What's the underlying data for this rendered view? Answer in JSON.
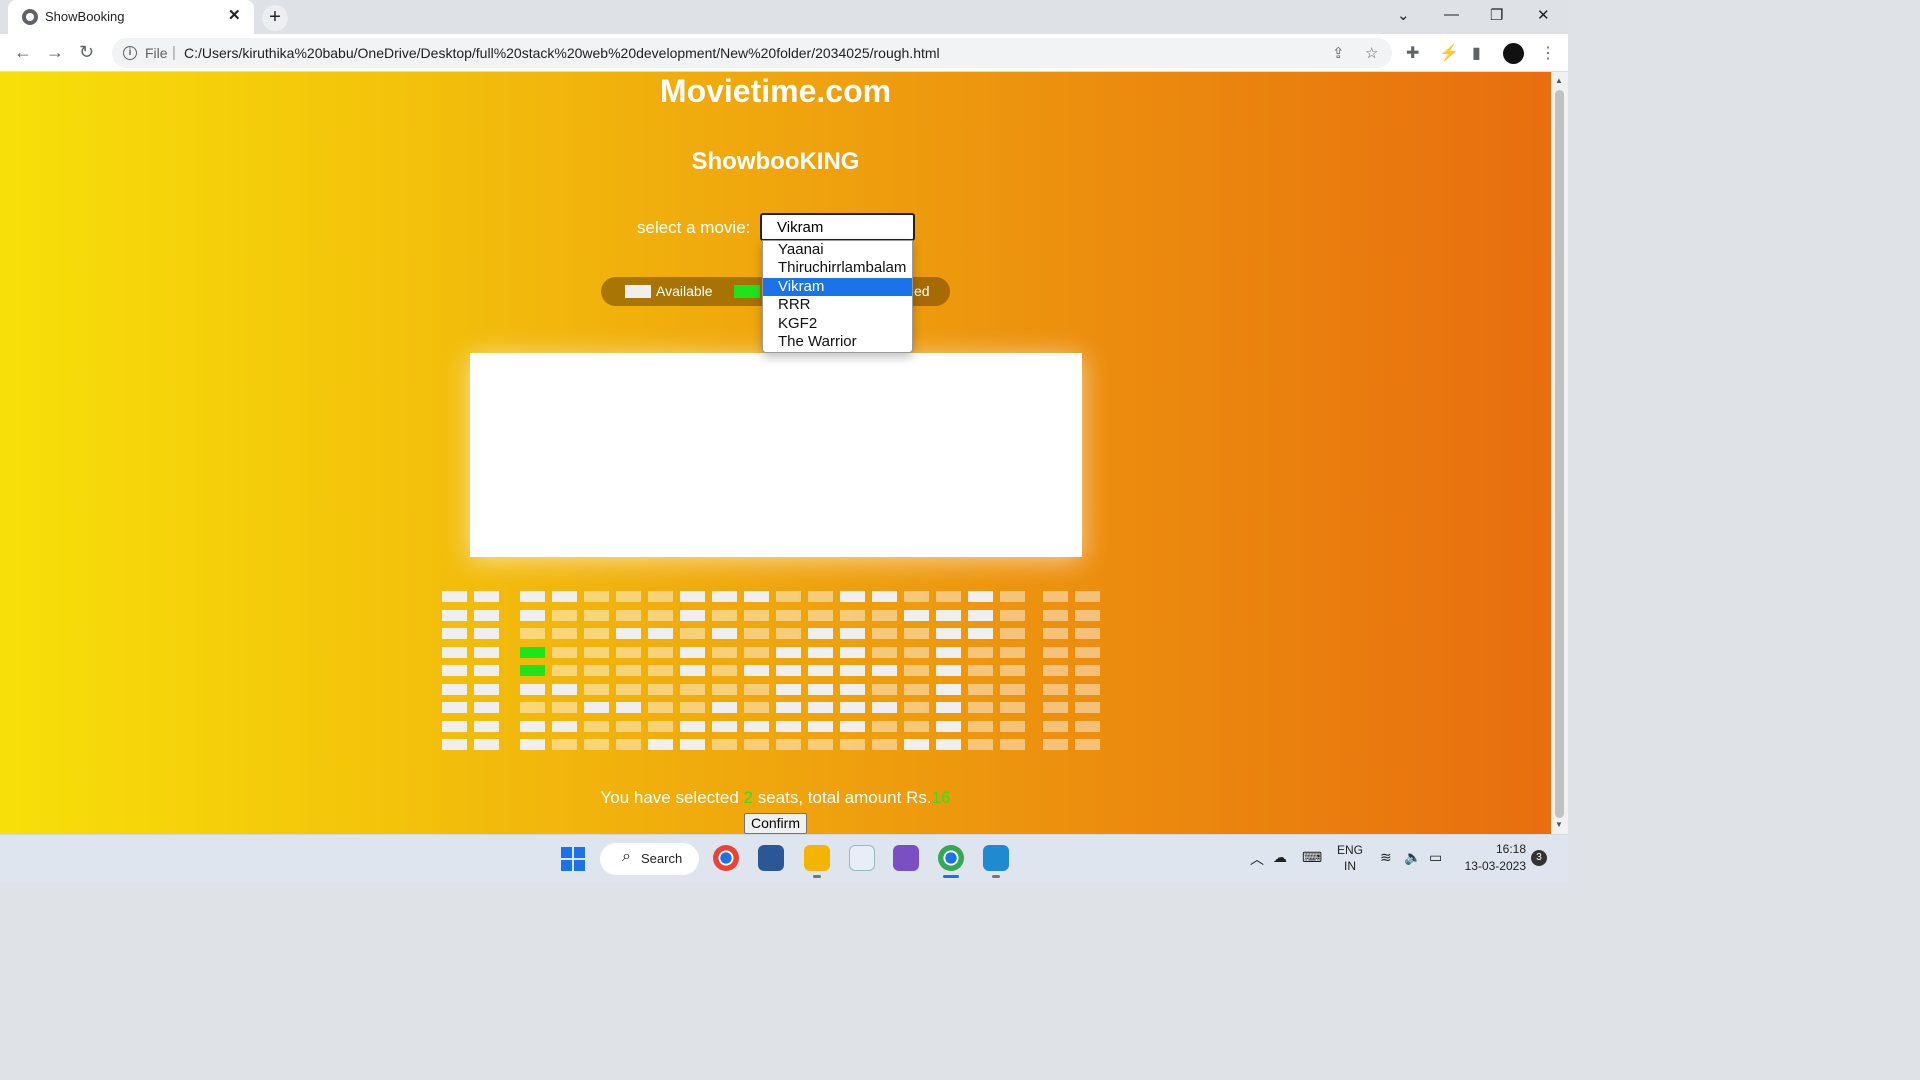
{
  "browser": {
    "tab_title": "ShowBooking",
    "tab_close": "✕",
    "new_tab": "+",
    "scheme_label": "File",
    "url_separator": "|",
    "url": "C:/Users/kiruthika%20babu/OneDrive/Desktop/full%20stack%20web%20development/New%20folder/2034025/rough.html",
    "icons": [
      "back-icon",
      "forward-icon",
      "reload-icon",
      "info-icon",
      "share-icon",
      "star-icon",
      "extensions-icon",
      "performance-icon",
      "side-panel-icon",
      "profile-avatar",
      "menu-icon",
      "minimize-icon",
      "restore-icon",
      "close-icon",
      "tab-search-icon"
    ]
  },
  "page": {
    "site_title": "Movietime.com",
    "sub_title": "ShowbooKING",
    "select_label": "select a movie:",
    "selected_movie": "Vikram",
    "movie_options": [
      "Yaanai",
      "Thiruchirrlambalam",
      "Vikram",
      "RRR",
      "KGF2",
      "The Warrior"
    ],
    "legend": {
      "available_label": "Available",
      "occupied_label_visible": "ed"
    },
    "summary": {
      "prefix": "You have selected ",
      "count": "2",
      "middle": " seats, total amount Rs.",
      "amount": "16"
    },
    "confirm_label": "Confirm",
    "colors": {
      "available": "#efefef",
      "selected": "#1ee51a",
      "occupied": "rgba(255,255,255,0.45)",
      "gradient_start": "#f7e009",
      "gradient_end": "#e86e0f"
    },
    "seating": {
      "rows": 9,
      "columns": 19,
      "legend_states": "A = available, O = occupied, S = selected",
      "map": [
        "AAAAOOOAAAOOAAOOAOOO",
        "AAAOOOOAOOOOOOAAAOOO",
        "AAOOOAAOAOOAAOOAAOOO",
        "AASOOOOAOOAAAOOAOOOO",
        "AASOOOOAOAAAAAOAOOOO",
        "AAAAOOOOOOAAAOOAOOOO",
        "AAOOAAOOAOAAAAOAOOOO",
        "AAAAOOOAAAAAAOOAOOOO",
        "AAAOOOAAOOOOOOAAOOOO"
      ]
    }
  },
  "taskbar": {
    "search_label": "Search",
    "apps": [
      "chrome-icon",
      "store-icon",
      "file-explorer-icon",
      "word-icon",
      "visual-studio-icon",
      "chrome-active-icon",
      "vscode-icon"
    ],
    "lang_top": "ENG",
    "lang_bottom": "IN",
    "time": "16:18",
    "date": "13-03-2023",
    "notifications": "3"
  }
}
